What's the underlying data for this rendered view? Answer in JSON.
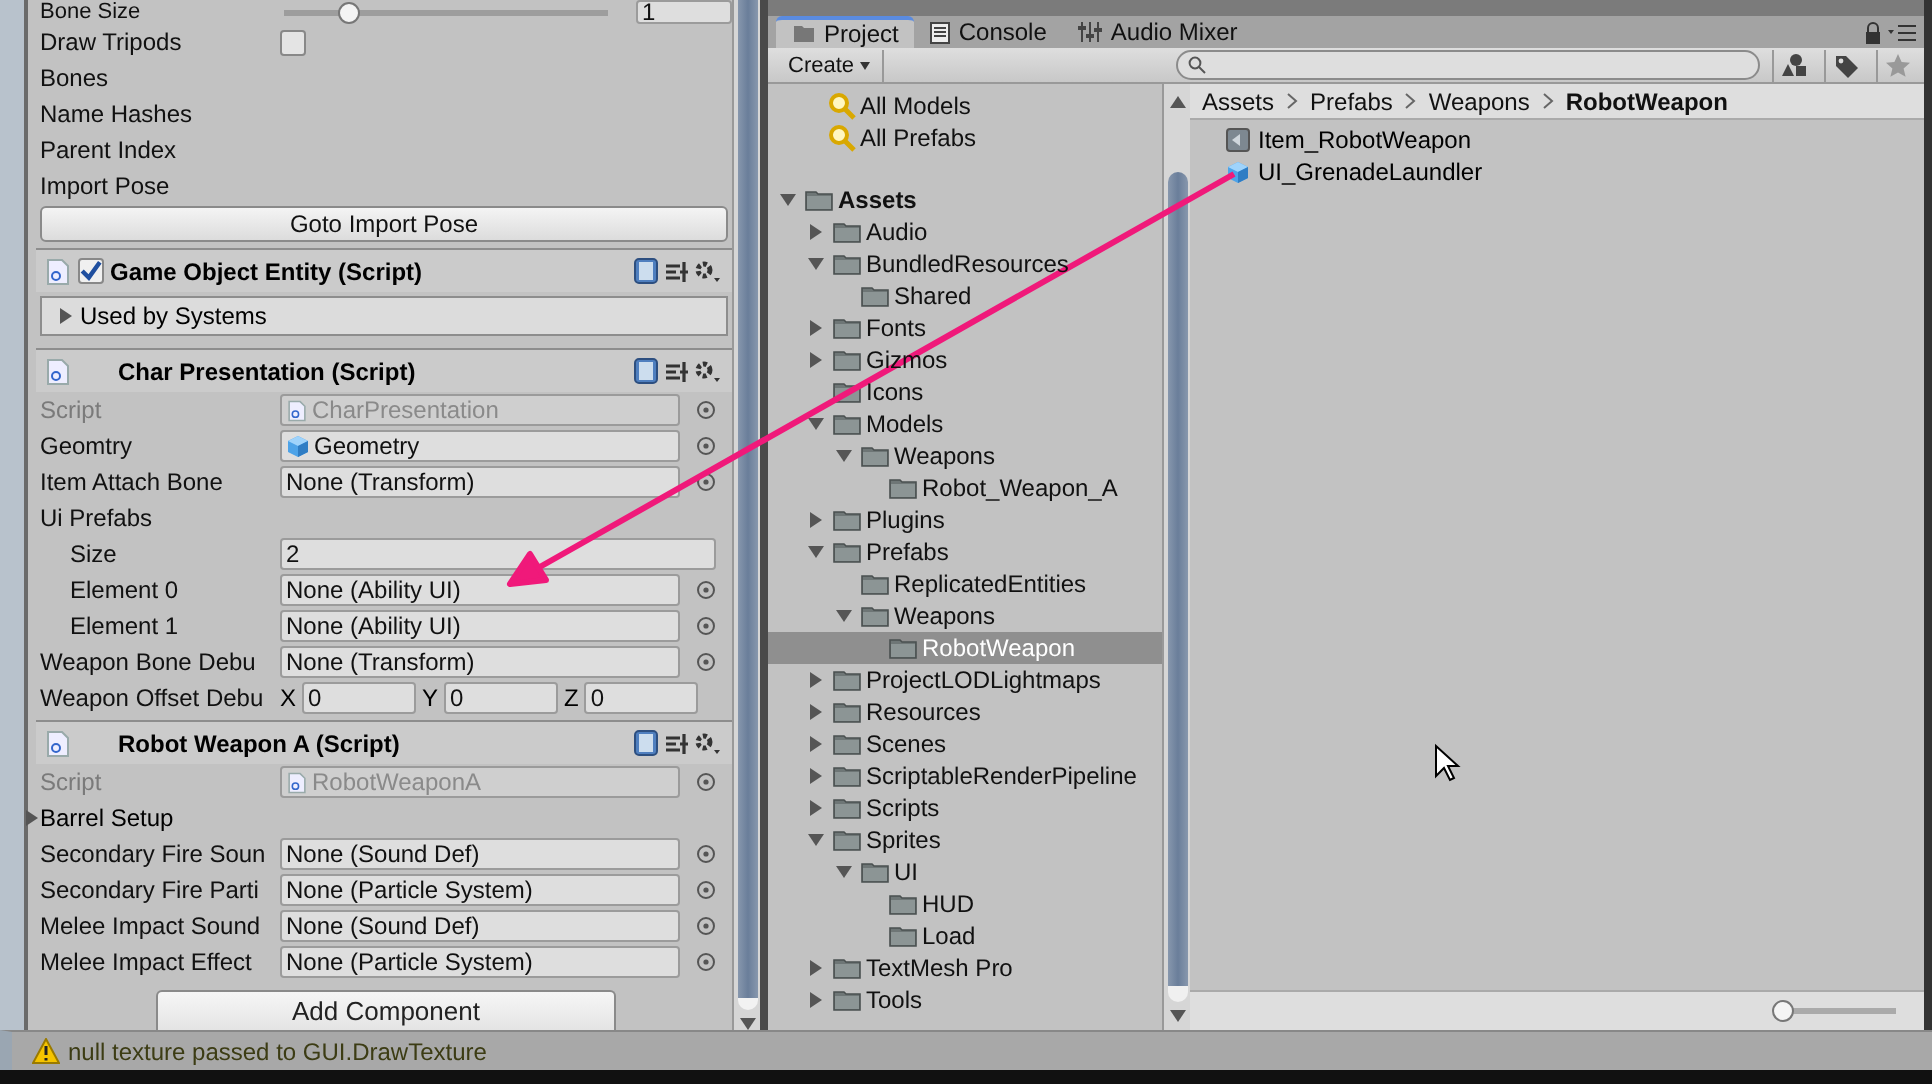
{
  "inspector": {
    "bone_size": {
      "label": "Bone Size",
      "level": 0.2,
      "value": "1"
    },
    "rows": [
      {
        "kind": "checkbox",
        "label": "Draw Tripods",
        "checked": false
      },
      {
        "kind": "label",
        "label": "Bones"
      },
      {
        "kind": "label",
        "label": "Name Hashes"
      },
      {
        "kind": "label",
        "label": "Parent Index"
      },
      {
        "kind": "label",
        "label": "Import Pose"
      },
      {
        "kind": "button",
        "label": "Goto Import Pose"
      }
    ],
    "components": [
      {
        "title": "Game Object Entity (Script)",
        "enabled": true,
        "properties": [
          {
            "kind": "foldout_box",
            "label": "Used by Systems",
            "expanded": false
          }
        ]
      },
      {
        "title": "Char Presentation (Script)",
        "properties": [
          {
            "kind": "script",
            "label": "Script",
            "value": "CharPresentation"
          },
          {
            "kind": "asset",
            "label": "Geomtry",
            "value": "Geometry"
          },
          {
            "kind": "object",
            "label": "Item Attach Bone",
            "value": "None (Transform)"
          },
          {
            "kind": "array",
            "label": "Ui Prefabs",
            "children": [
              {
                "kind": "text",
                "label": "Size",
                "value": "2"
              },
              {
                "kind": "object",
                "label": "Element 0",
                "value": "None (Ability UI)"
              },
              {
                "kind": "object",
                "label": "Element 1",
                "value": "None (Ability UI)"
              }
            ]
          },
          {
            "kind": "object",
            "label": "Weapon Bone Debu",
            "value": "None (Transform)"
          },
          {
            "kind": "vector3",
            "label": "Weapon Offset Debu",
            "axes": [
              {
                "axis": "X",
                "value": "0"
              },
              {
                "axis": "Y",
                "value": "0"
              },
              {
                "axis": "Z",
                "value": "0"
              }
            ]
          }
        ]
      },
      {
        "title": "Robot Weapon A (Script)",
        "properties": [
          {
            "kind": "script",
            "label": "Script",
            "value": "RobotWeaponA"
          },
          {
            "kind": "foldout",
            "label": "Barrel Setup",
            "expanded": false
          },
          {
            "kind": "object",
            "label": "Secondary Fire Soun",
            "value": "None (Sound Def)"
          },
          {
            "kind": "object",
            "label": "Secondary Fire Parti",
            "value": "None (Particle System)"
          },
          {
            "kind": "object",
            "label": "Melee Impact Sound",
            "value": "None (Sound Def)"
          },
          {
            "kind": "object",
            "label": "Melee Impact Effect",
            "value": "None (Particle System)"
          }
        ]
      }
    ],
    "add_button": "Add Component"
  },
  "project": {
    "tabs": [
      {
        "label": "Project",
        "kind": "project",
        "selected": true
      },
      {
        "label": "Console",
        "kind": "console",
        "selected": false
      },
      {
        "label": "Audio Mixer",
        "kind": "mixer",
        "selected": false
      }
    ],
    "create_button": "Create",
    "favorites": [
      "All Models",
      "All Prefabs"
    ],
    "tree": [
      {
        "label": "Assets",
        "expanded": true,
        "selected": false,
        "children": [
          {
            "label": "Audio",
            "expanded": false,
            "selected": false
          },
          {
            "label": "BundledResources",
            "expanded": true,
            "selected": false,
            "children": [
              {
                "label": "Shared",
                "selected": false
              }
            ]
          },
          {
            "label": "Fonts",
            "expanded": false,
            "selected": false
          },
          {
            "label": "Gizmos",
            "expanded": false,
            "selected": false
          },
          {
            "label": "Icons",
            "selected": false
          },
          {
            "label": "Models",
            "expanded": true,
            "selected": false,
            "children": [
              {
                "label": "Weapons",
                "expanded": true,
                "selected": false,
                "children": [
                  {
                    "label": "Robot_Weapon_A",
                    "selected": false
                  }
                ]
              }
            ]
          },
          {
            "label": "Plugins",
            "expanded": false,
            "selected": false
          },
          {
            "label": "Prefabs",
            "expanded": true,
            "selected": false,
            "children": [
              {
                "label": "ReplicatedEntities",
                "selected": false
              },
              {
                "label": "Weapons",
                "expanded": true,
                "selected": false,
                "children": [
                  {
                    "label": "RobotWeapon",
                    "selected": true
                  }
                ]
              }
            ]
          },
          {
            "label": "ProjectLODLightmaps",
            "expanded": false,
            "selected": false
          },
          {
            "label": "Resources",
            "expanded": false,
            "selected": false
          },
          {
            "label": "Scenes",
            "expanded": false,
            "selected": false
          },
          {
            "label": "ScriptableRenderPipeline",
            "expanded": false,
            "selected": false
          },
          {
            "label": "Scripts",
            "expanded": false,
            "selected": false
          },
          {
            "label": "Sprites",
            "expanded": true,
            "selected": false,
            "children": [
              {
                "label": "UI",
                "expanded": true,
                "selected": false,
                "children": [
                  {
                    "label": "HUD",
                    "selected": false
                  },
                  {
                    "label": "Load",
                    "selected": false
                  }
                ]
              }
            ]
          },
          {
            "label": "TextMesh Pro",
            "expanded": false,
            "selected": false
          },
          {
            "label": "Tools",
            "expanded": false,
            "selected": false
          }
        ]
      }
    ],
    "breadcrumb": [
      "Assets",
      "Prefabs",
      "Weapons",
      "RobotWeapon"
    ],
    "files": [
      {
        "label": "Item_RobotWeapon",
        "kind": "asset"
      },
      {
        "label": "UI_GrenadeLaundler",
        "kind": "prefab"
      }
    ],
    "zoom_slider": {
      "level": 0.05
    }
  },
  "status_bar": {
    "message": "null texture passed to GUI.DrawTexture"
  }
}
